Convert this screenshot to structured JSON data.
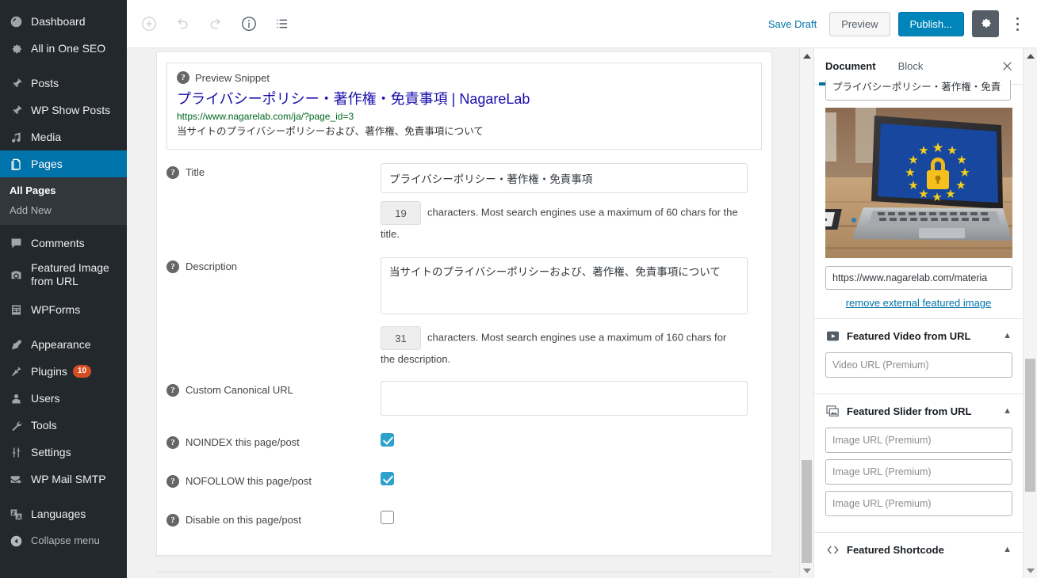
{
  "sidebar": {
    "items": [
      {
        "label": "Dashboard",
        "icon": "dashboard-icon",
        "name": "dashboard"
      },
      {
        "label": "All in One SEO",
        "icon": "gear-icon",
        "name": "all-in-one-seo"
      },
      {
        "label": "Posts",
        "icon": "pin-icon",
        "name": "posts"
      },
      {
        "label": "WP Show Posts",
        "icon": "pin-icon",
        "name": "wp-show-posts"
      },
      {
        "label": "Media",
        "icon": "media-icon",
        "name": "media"
      },
      {
        "label": "Pages",
        "icon": "pages-icon",
        "name": "pages",
        "current": true
      },
      {
        "label": "Comments",
        "icon": "comment-icon",
        "name": "comments"
      },
      {
        "label": "Featured Image\nfrom URL",
        "icon": "camera-icon",
        "name": "featured-image-from-url"
      },
      {
        "label": "WPForms",
        "icon": "form-icon",
        "name": "wpforms"
      },
      {
        "label": "Appearance",
        "icon": "brush-icon",
        "name": "appearance"
      },
      {
        "label": "Plugins",
        "icon": "plug-icon",
        "name": "plugins",
        "badge": "10"
      },
      {
        "label": "Users",
        "icon": "user-icon",
        "name": "users"
      },
      {
        "label": "Tools",
        "icon": "wrench-icon",
        "name": "tools"
      },
      {
        "label": "Settings",
        "icon": "sliders-icon",
        "name": "settings"
      },
      {
        "label": "WP Mail SMTP",
        "icon": "envelope-icon",
        "name": "wp-mail-smtp"
      },
      {
        "label": "Languages",
        "icon": "translate-icon",
        "name": "languages"
      }
    ],
    "submenu": [
      {
        "label": "All Pages",
        "current": true
      },
      {
        "label": "Add New",
        "current": false
      }
    ],
    "collapse_label": "Collapse menu",
    "highlight_color": "#0073aa",
    "badge_color": "#d54e21"
  },
  "header": {
    "save_draft_label": "Save Draft",
    "preview_label": "Preview",
    "publish_label": "Publish...",
    "publish_color": "#0085ba",
    "tools": [
      {
        "name": "add-block-icon",
        "title": "Add block"
      },
      {
        "name": "undo-icon",
        "title": "Undo"
      },
      {
        "name": "redo-icon",
        "title": "Redo"
      },
      {
        "name": "info-icon",
        "title": "Content structure"
      },
      {
        "name": "block-navigation-icon",
        "title": "Block navigation"
      }
    ]
  },
  "aioseo": {
    "preview_snippet_label": "Preview Snippet",
    "snippet_title": "プライバシーポリシー・著作権・免責事項 | NagareLab",
    "snippet_url": "https://www.nagarelab.com/ja/?page_id=3",
    "snippet_desc": "当サイトのプライバシーポリシーおよび、著作権、免責事項について",
    "snippet_title_color": "#1a0dab",
    "snippet_url_color": "#006621",
    "title_label": "Title",
    "title_value": "プライバシーポリシー・著作権・免責事項",
    "title_count": "19",
    "title_count_text": "characters. Most search engines use a maximum of 60 chars for the title.",
    "description_label": "Description",
    "description_value": "当サイトのプライバシーポリシーおよび、著作権、免責事項について",
    "description_count": "31",
    "description_count_text": "characters. Most search engines use a maximum of 160 chars for the description.",
    "canonical_label": "Custom Canonical URL",
    "canonical_value": "",
    "noindex_label": "NOINDEX this page/post",
    "noindex_checked": true,
    "nofollow_label": "NOFOLLOW this page/post",
    "nofollow_checked": true,
    "disable_label": "Disable on this page/post",
    "disable_checked": false,
    "checkbox_color": "#2ea2cc"
  },
  "panel": {
    "tab_document": "Document",
    "tab_block": "Block",
    "close_icon": "close-icon",
    "active_tab": "Document",
    "tab_underline_color": "#00739c",
    "clipped_input_value": "プライバシーポリシー・著作権・免責",
    "featured_image_url": "https://www.nagarelab.com/materia",
    "remove_image_link": "remove external featured image",
    "sections": [
      {
        "title": "Featured Video from URL",
        "icon": "play-icon",
        "chevron": "chevron-up-icon",
        "inputs": [
          {
            "placeholder": "Video URL (Premium)"
          }
        ]
      },
      {
        "title": "Featured Slider from URL",
        "icon": "images-icon",
        "chevron": "chevron-up-icon",
        "inputs": [
          {
            "placeholder": "Image URL (Premium)"
          },
          {
            "placeholder": "Image URL (Premium)"
          },
          {
            "placeholder": "Image URL (Premium)"
          }
        ]
      },
      {
        "title": "Featured Shortcode",
        "icon": "code-icon",
        "chevron": "chevron-up-icon",
        "inputs": []
      }
    ]
  }
}
